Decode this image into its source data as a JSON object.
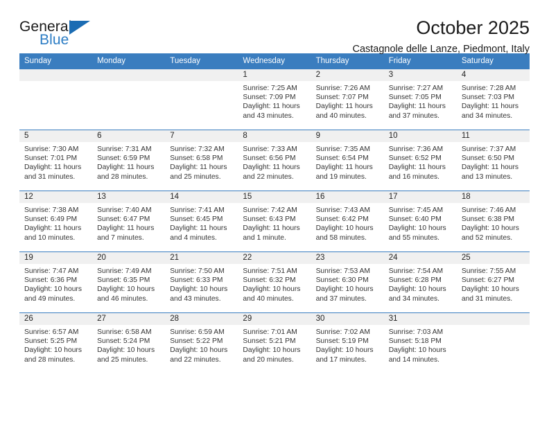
{
  "brand": {
    "name_top": "General",
    "name_bottom": "Blue",
    "triangle_color": "#1b6cb3",
    "blue_color": "#2b7cc4"
  },
  "header": {
    "title": "October 2025",
    "subtitle": "Castagnole delle Lanze, Piedmont, Italy"
  },
  "theme": {
    "header_band": "#3a7dbf",
    "date_band": "#f0f0f0",
    "text": "#222222"
  },
  "weekday_headers": [
    "Sunday",
    "Monday",
    "Tuesday",
    "Wednesday",
    "Thursday",
    "Friday",
    "Saturday"
  ],
  "labels": {
    "sunrise_prefix": "Sunrise:",
    "sunset_prefix": "Sunset:",
    "daylight_prefix": "Daylight:"
  },
  "weeks": [
    [
      {
        "date": "",
        "empty": true,
        "sunrise": "",
        "sunset": "",
        "daylight_line1": "",
        "daylight_line2": ""
      },
      {
        "date": "",
        "empty": true,
        "sunrise": "",
        "sunset": "",
        "daylight_line1": "",
        "daylight_line2": ""
      },
      {
        "date": "",
        "empty": true,
        "sunrise": "",
        "sunset": "",
        "daylight_line1": "",
        "daylight_line2": ""
      },
      {
        "date": "1",
        "empty": false,
        "sunrise": "Sunrise: 7:25 AM",
        "sunset": "Sunset: 7:09 PM",
        "daylight_line1": "Daylight: 11 hours",
        "daylight_line2": "and 43 minutes."
      },
      {
        "date": "2",
        "empty": false,
        "sunrise": "Sunrise: 7:26 AM",
        "sunset": "Sunset: 7:07 PM",
        "daylight_line1": "Daylight: 11 hours",
        "daylight_line2": "and 40 minutes."
      },
      {
        "date": "3",
        "empty": false,
        "sunrise": "Sunrise: 7:27 AM",
        "sunset": "Sunset: 7:05 PM",
        "daylight_line1": "Daylight: 11 hours",
        "daylight_line2": "and 37 minutes."
      },
      {
        "date": "4",
        "empty": false,
        "sunrise": "Sunrise: 7:28 AM",
        "sunset": "Sunset: 7:03 PM",
        "daylight_line1": "Daylight: 11 hours",
        "daylight_line2": "and 34 minutes."
      }
    ],
    [
      {
        "date": "5",
        "empty": false,
        "sunrise": "Sunrise: 7:30 AM",
        "sunset": "Sunset: 7:01 PM",
        "daylight_line1": "Daylight: 11 hours",
        "daylight_line2": "and 31 minutes."
      },
      {
        "date": "6",
        "empty": false,
        "sunrise": "Sunrise: 7:31 AM",
        "sunset": "Sunset: 6:59 PM",
        "daylight_line1": "Daylight: 11 hours",
        "daylight_line2": "and 28 minutes."
      },
      {
        "date": "7",
        "empty": false,
        "sunrise": "Sunrise: 7:32 AM",
        "sunset": "Sunset: 6:58 PM",
        "daylight_line1": "Daylight: 11 hours",
        "daylight_line2": "and 25 minutes."
      },
      {
        "date": "8",
        "empty": false,
        "sunrise": "Sunrise: 7:33 AM",
        "sunset": "Sunset: 6:56 PM",
        "daylight_line1": "Daylight: 11 hours",
        "daylight_line2": "and 22 minutes."
      },
      {
        "date": "9",
        "empty": false,
        "sunrise": "Sunrise: 7:35 AM",
        "sunset": "Sunset: 6:54 PM",
        "daylight_line1": "Daylight: 11 hours",
        "daylight_line2": "and 19 minutes."
      },
      {
        "date": "10",
        "empty": false,
        "sunrise": "Sunrise: 7:36 AM",
        "sunset": "Sunset: 6:52 PM",
        "daylight_line1": "Daylight: 11 hours",
        "daylight_line2": "and 16 minutes."
      },
      {
        "date": "11",
        "empty": false,
        "sunrise": "Sunrise: 7:37 AM",
        "sunset": "Sunset: 6:50 PM",
        "daylight_line1": "Daylight: 11 hours",
        "daylight_line2": "and 13 minutes."
      }
    ],
    [
      {
        "date": "12",
        "empty": false,
        "sunrise": "Sunrise: 7:38 AM",
        "sunset": "Sunset: 6:49 PM",
        "daylight_line1": "Daylight: 11 hours",
        "daylight_line2": "and 10 minutes."
      },
      {
        "date": "13",
        "empty": false,
        "sunrise": "Sunrise: 7:40 AM",
        "sunset": "Sunset: 6:47 PM",
        "daylight_line1": "Daylight: 11 hours",
        "daylight_line2": "and 7 minutes."
      },
      {
        "date": "14",
        "empty": false,
        "sunrise": "Sunrise: 7:41 AM",
        "sunset": "Sunset: 6:45 PM",
        "daylight_line1": "Daylight: 11 hours",
        "daylight_line2": "and 4 minutes."
      },
      {
        "date": "15",
        "empty": false,
        "sunrise": "Sunrise: 7:42 AM",
        "sunset": "Sunset: 6:43 PM",
        "daylight_line1": "Daylight: 11 hours",
        "daylight_line2": "and 1 minute."
      },
      {
        "date": "16",
        "empty": false,
        "sunrise": "Sunrise: 7:43 AM",
        "sunset": "Sunset: 6:42 PM",
        "daylight_line1": "Daylight: 10 hours",
        "daylight_line2": "and 58 minutes."
      },
      {
        "date": "17",
        "empty": false,
        "sunrise": "Sunrise: 7:45 AM",
        "sunset": "Sunset: 6:40 PM",
        "daylight_line1": "Daylight: 10 hours",
        "daylight_line2": "and 55 minutes."
      },
      {
        "date": "18",
        "empty": false,
        "sunrise": "Sunrise: 7:46 AM",
        "sunset": "Sunset: 6:38 PM",
        "daylight_line1": "Daylight: 10 hours",
        "daylight_line2": "and 52 minutes."
      }
    ],
    [
      {
        "date": "19",
        "empty": false,
        "sunrise": "Sunrise: 7:47 AM",
        "sunset": "Sunset: 6:36 PM",
        "daylight_line1": "Daylight: 10 hours",
        "daylight_line2": "and 49 minutes."
      },
      {
        "date": "20",
        "empty": false,
        "sunrise": "Sunrise: 7:49 AM",
        "sunset": "Sunset: 6:35 PM",
        "daylight_line1": "Daylight: 10 hours",
        "daylight_line2": "and 46 minutes."
      },
      {
        "date": "21",
        "empty": false,
        "sunrise": "Sunrise: 7:50 AM",
        "sunset": "Sunset: 6:33 PM",
        "daylight_line1": "Daylight: 10 hours",
        "daylight_line2": "and 43 minutes."
      },
      {
        "date": "22",
        "empty": false,
        "sunrise": "Sunrise: 7:51 AM",
        "sunset": "Sunset: 6:32 PM",
        "daylight_line1": "Daylight: 10 hours",
        "daylight_line2": "and 40 minutes."
      },
      {
        "date": "23",
        "empty": false,
        "sunrise": "Sunrise: 7:53 AM",
        "sunset": "Sunset: 6:30 PM",
        "daylight_line1": "Daylight: 10 hours",
        "daylight_line2": "and 37 minutes."
      },
      {
        "date": "24",
        "empty": false,
        "sunrise": "Sunrise: 7:54 AM",
        "sunset": "Sunset: 6:28 PM",
        "daylight_line1": "Daylight: 10 hours",
        "daylight_line2": "and 34 minutes."
      },
      {
        "date": "25",
        "empty": false,
        "sunrise": "Sunrise: 7:55 AM",
        "sunset": "Sunset: 6:27 PM",
        "daylight_line1": "Daylight: 10 hours",
        "daylight_line2": "and 31 minutes."
      }
    ],
    [
      {
        "date": "26",
        "empty": false,
        "sunrise": "Sunrise: 6:57 AM",
        "sunset": "Sunset: 5:25 PM",
        "daylight_line1": "Daylight: 10 hours",
        "daylight_line2": "and 28 minutes."
      },
      {
        "date": "27",
        "empty": false,
        "sunrise": "Sunrise: 6:58 AM",
        "sunset": "Sunset: 5:24 PM",
        "daylight_line1": "Daylight: 10 hours",
        "daylight_line2": "and 25 minutes."
      },
      {
        "date": "28",
        "empty": false,
        "sunrise": "Sunrise: 6:59 AM",
        "sunset": "Sunset: 5:22 PM",
        "daylight_line1": "Daylight: 10 hours",
        "daylight_line2": "and 22 minutes."
      },
      {
        "date": "29",
        "empty": false,
        "sunrise": "Sunrise: 7:01 AM",
        "sunset": "Sunset: 5:21 PM",
        "daylight_line1": "Daylight: 10 hours",
        "daylight_line2": "and 20 minutes."
      },
      {
        "date": "30",
        "empty": false,
        "sunrise": "Sunrise: 7:02 AM",
        "sunset": "Sunset: 5:19 PM",
        "daylight_line1": "Daylight: 10 hours",
        "daylight_line2": "and 17 minutes."
      },
      {
        "date": "31",
        "empty": false,
        "sunrise": "Sunrise: 7:03 AM",
        "sunset": "Sunset: 5:18 PM",
        "daylight_line1": "Daylight: 10 hours",
        "daylight_line2": "and 14 minutes."
      },
      {
        "date": "",
        "empty": true,
        "sunrise": "",
        "sunset": "",
        "daylight_line1": "",
        "daylight_line2": ""
      }
    ]
  ]
}
